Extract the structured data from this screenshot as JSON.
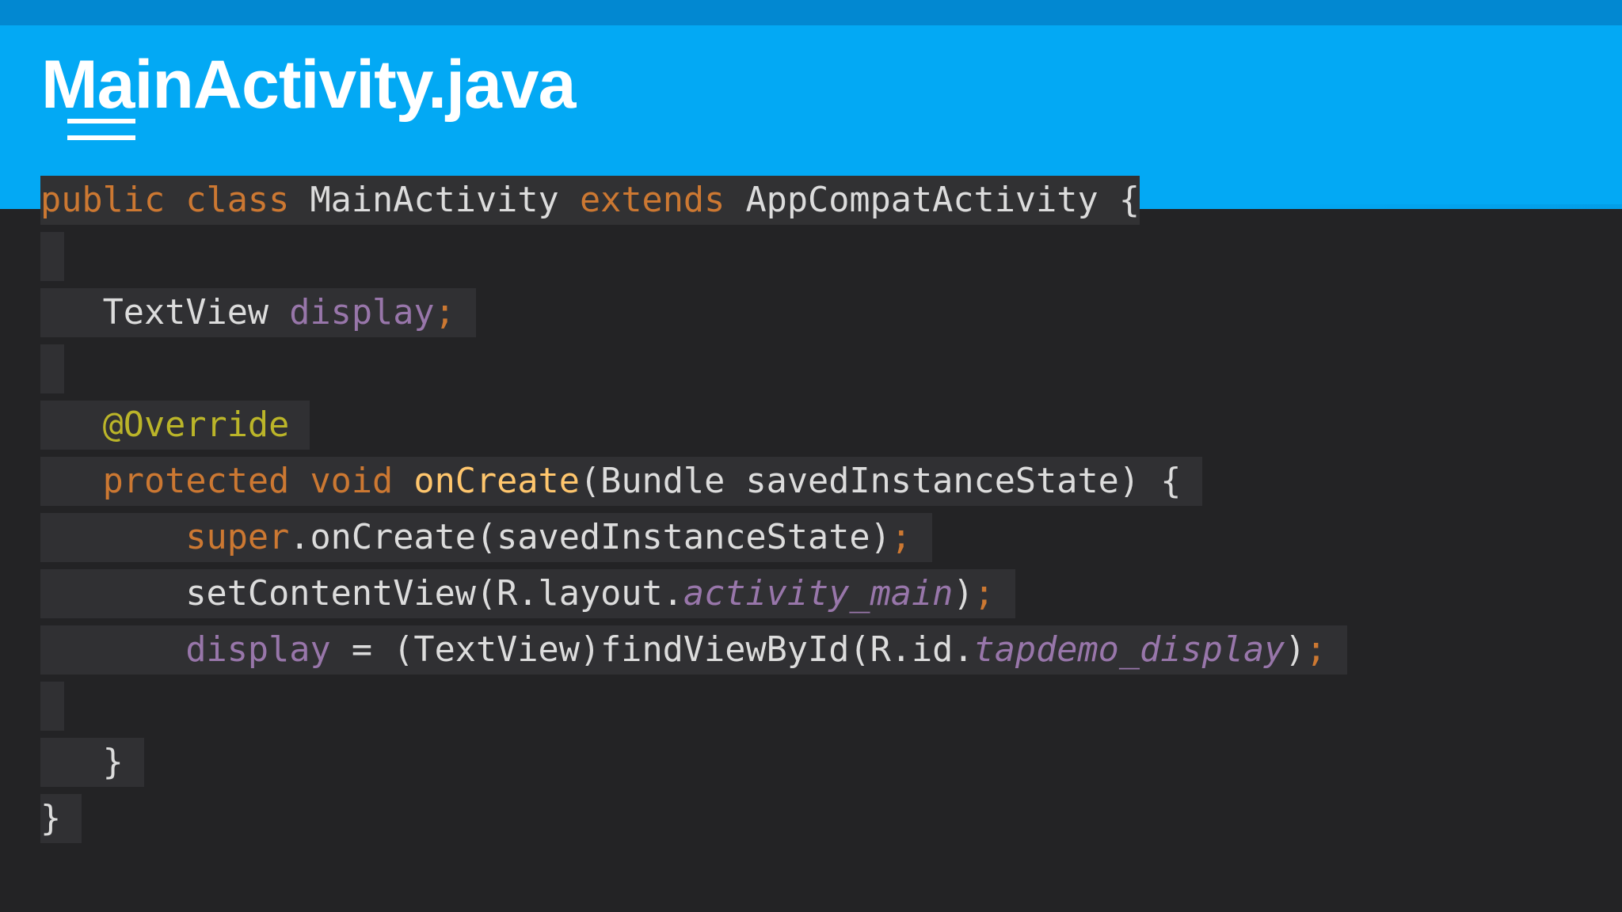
{
  "slide": {
    "title": "MainActivity.java"
  },
  "code": {
    "language": "java",
    "lines": [
      "public class MainActivity extends AppCompatActivity {",
      "",
      "    TextView display;",
      "",
      "    @Override",
      "    protected void onCreate(Bundle savedInstanceState) {",
      "        super.onCreate(savedInstanceState);",
      "        setContentView(R.layout.activity_main);",
      "        display = (TextView)findViewById(R.id.tapdemo_display);",
      "",
      "    }",
      "}"
    ]
  },
  "colors": {
    "header": "#03a9f4",
    "header_strip": "#0288d1",
    "background": "#232325",
    "line_highlight": "#303033",
    "text": "#dcdcdc",
    "keyword": "#cc7832",
    "field": "#9876aa",
    "annotation": "#bbb529",
    "method": "#ffc66d"
  }
}
